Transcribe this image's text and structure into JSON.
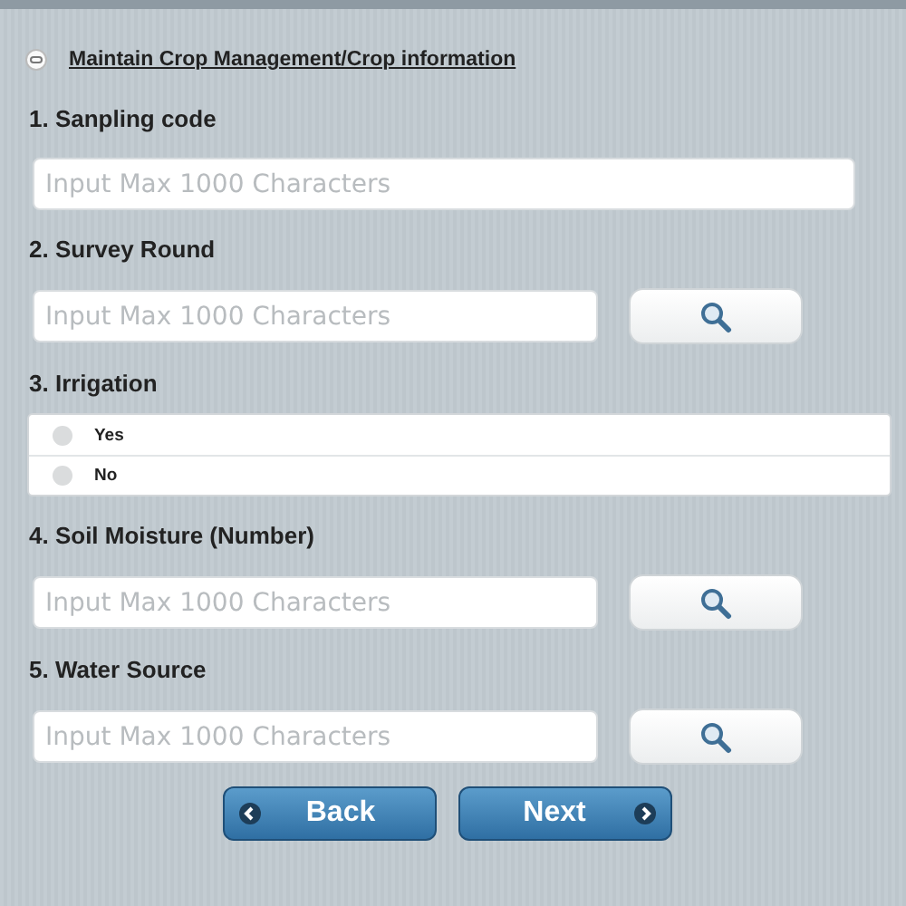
{
  "header": {
    "title": "Maintain Crop Management/Crop information"
  },
  "questions": [
    {
      "kind": "text",
      "label": "1. Sanpling code",
      "placeholder": "Input Max 1000 Characters"
    },
    {
      "kind": "lookup",
      "label": "2. Survey Round",
      "placeholder": "Input Max 1000 Characters"
    },
    {
      "kind": "radio",
      "label": "3. Irrigation",
      "options": [
        {
          "label": "Yes",
          "selected": false
        },
        {
          "label": "No",
          "selected": false
        }
      ]
    },
    {
      "kind": "lookup",
      "label": "4. Soil Moisture (Number)",
      "placeholder": "Input Max 1000 Characters"
    },
    {
      "kind": "lookup",
      "label": "5. Water Source",
      "placeholder": "Input Max 1000 Characters"
    }
  ],
  "buttons": [
    {
      "kind": "back",
      "label": "Back"
    },
    {
      "kind": "next",
      "label": "Next"
    }
  ]
}
